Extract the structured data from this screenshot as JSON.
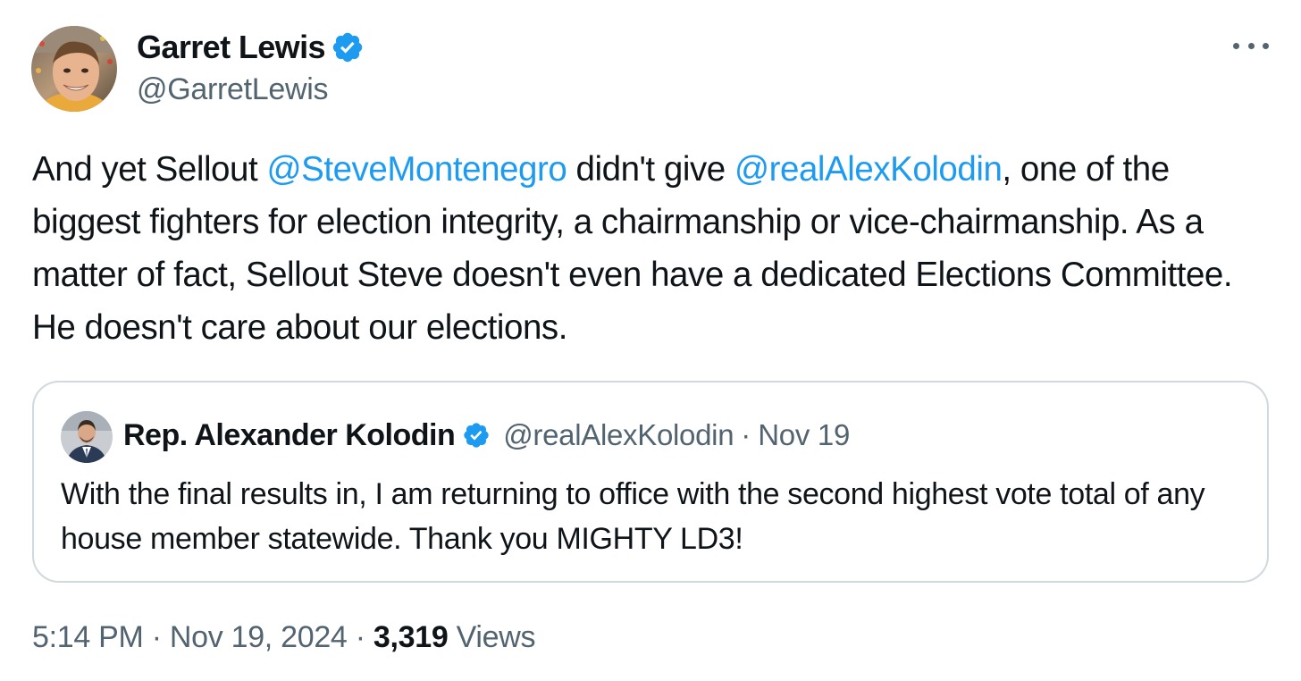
{
  "tweet": {
    "author": {
      "name": "Garret Lewis",
      "handle": "@GarretLewis",
      "verified": true
    },
    "body": {
      "seg1": "And yet Sellout ",
      "mention1": "@SteveMontenegro",
      "seg2": " didn't give ",
      "mention2": "@realAlexKolodin",
      "seg3": ", one of the biggest fighters for election integrity, a chairmanship or vice-chairmanship. As a matter of fact, Sellout Steve doesn't even have a dedicated Elections Committee.  He doesn't care about our elections."
    },
    "quoted": {
      "name": "Rep. Alexander Kolodin",
      "handle": "@realAlexKolodin",
      "separator": "·",
      "date": "Nov 19",
      "text": "With the final results in, I am returning to office with the second highest vote total of any house member statewide. Thank you MIGHTY LD3!"
    },
    "meta": {
      "time": "5:14 PM",
      "separator": "·",
      "date": "Nov 19, 2024",
      "views_count": "3,319",
      "views_label": "Views"
    }
  },
  "colors": {
    "link": "#1d9bf0",
    "secondary_text": "#536471",
    "primary_text": "#0f1419",
    "border": "#cfd9de",
    "verified_badge": "#1d9bf0"
  },
  "icons": {
    "verified": "verified-badge-icon",
    "more": "more-horizontal-icon"
  }
}
